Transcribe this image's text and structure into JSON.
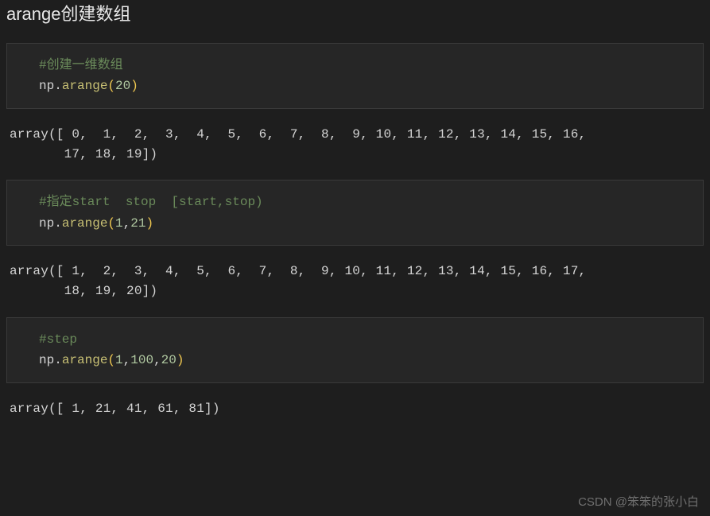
{
  "title": "arange创建数组",
  "blocks": {
    "b1": {
      "comment": "#创建一维数组",
      "ns": "np",
      "dot": ".",
      "func": "arange",
      "lp": "(",
      "args": "20",
      "rp": ")"
    },
    "o1": "array([ 0,  1,  2,  3,  4,  5,  6,  7,  8,  9, 10, 11, 12, 13, 14, 15, 16,\n       17, 18, 19])",
    "b2": {
      "comment": "#指定start  stop  [start,stop)",
      "ns": "np",
      "dot": ".",
      "func": "arange",
      "lp": "(",
      "a1": "1",
      "c1": ",",
      "a2": "21",
      "rp": ")"
    },
    "o2": "array([ 1,  2,  3,  4,  5,  6,  7,  8,  9, 10, 11, 12, 13, 14, 15, 16, 17,\n       18, 19, 20])",
    "b3": {
      "comment": "#step",
      "ns": "np",
      "dot": ".",
      "func": "arange",
      "lp": "(",
      "a1": "1",
      "c1": ",",
      "a2": "100",
      "c2": ",",
      "a3": "20",
      "rp": ")"
    },
    "o3": "array([ 1, 21, 41, 61, 81])"
  },
  "watermark": "CSDN @笨笨的张小白"
}
